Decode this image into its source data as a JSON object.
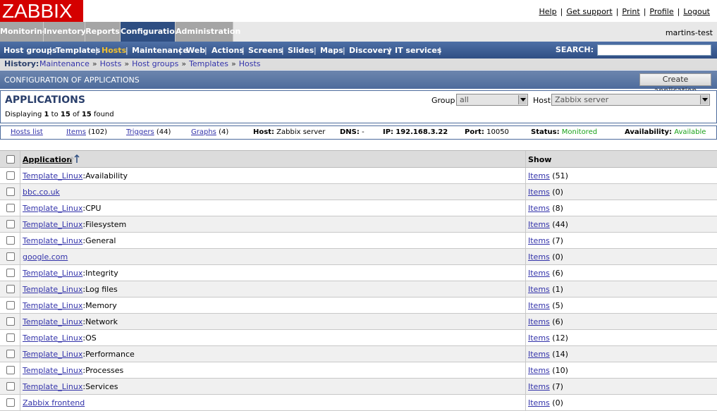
{
  "logo": "ZABBIX",
  "top_links": [
    "Help",
    "Get support",
    "Print",
    "Profile",
    "Logout"
  ],
  "main_menu": [
    {
      "label": "Monitoring",
      "active": false
    },
    {
      "label": "Inventory",
      "active": false
    },
    {
      "label": "Reports",
      "active": false
    },
    {
      "label": "Configuration",
      "active": true
    },
    {
      "label": "Administration",
      "active": false
    }
  ],
  "user": "martins-test",
  "sub_menu": [
    {
      "label": "Host groups",
      "active": false
    },
    {
      "label": "Templates",
      "active": false
    },
    {
      "label": "Hosts",
      "active": true
    },
    {
      "label": "Maintenance",
      "active": false
    },
    {
      "label": "Web",
      "active": false
    },
    {
      "label": "Actions",
      "active": false
    },
    {
      "label": "Screens",
      "active": false
    },
    {
      "label": "Slides",
      "active": false
    },
    {
      "label": "Maps",
      "active": false
    },
    {
      "label": "Discovery",
      "active": false
    },
    {
      "label": "IT services",
      "active": false
    }
  ],
  "search_label": "SEARCH:",
  "history": {
    "label": "History:",
    "crumbs": [
      "Maintenance",
      "Hosts",
      "Host groups",
      "Templates",
      "Hosts"
    ]
  },
  "config_bar": {
    "title": "CONFIGURATION OF APPLICATIONS",
    "create_button": "Create application"
  },
  "apps_panel": {
    "heading": "APPLICATIONS",
    "displaying": {
      "prefix": "Displaying",
      "from": "1",
      "to_word": "to",
      "to": "15",
      "of_word": "of",
      "total": "15",
      "suffix": "found"
    },
    "group_label": "Group",
    "group_value": "all",
    "host_label": "Host",
    "host_value": "Zabbix server"
  },
  "host_bar": {
    "hosts_list": "Hosts list",
    "items_label": "Items",
    "items_count": "(102)",
    "triggers_label": "Triggers",
    "triggers_count": "(44)",
    "graphs_label": "Graphs",
    "graphs_count": "(4)",
    "host_label": "Host:",
    "host_value": "Zabbix server",
    "dns_label": "DNS:",
    "dns_value": "-",
    "ip_label": "IP:",
    "ip_value": "192.168.3.22",
    "port_label": "Port:",
    "port_value": "10050",
    "status_label": "Status:",
    "status_value": "Monitored",
    "availability_label": "Availability:",
    "availability_value": "Available"
  },
  "table": {
    "col_application": "Application",
    "col_show": "Show",
    "rows": [
      {
        "prefix": "Template_Linux",
        "name": "Availability",
        "items": "Items",
        "count": "(51)"
      },
      {
        "prefix": "",
        "name": "bbc.co.uk",
        "items": "Items",
        "count": "(0)"
      },
      {
        "prefix": "Template_Linux",
        "name": "CPU",
        "items": "Items",
        "count": "(8)"
      },
      {
        "prefix": "Template_Linux",
        "name": "Filesystem",
        "items": "Items",
        "count": "(44)"
      },
      {
        "prefix": "Template_Linux",
        "name": "General",
        "items": "Items",
        "count": "(7)"
      },
      {
        "prefix": "",
        "name": "google.com",
        "items": "Items",
        "count": "(0)"
      },
      {
        "prefix": "Template_Linux",
        "name": "Integrity",
        "items": "Items",
        "count": "(6)"
      },
      {
        "prefix": "Template_Linux",
        "name": "Log files",
        "items": "Items",
        "count": "(1)"
      },
      {
        "prefix": "Template_Linux",
        "name": "Memory",
        "items": "Items",
        "count": "(5)"
      },
      {
        "prefix": "Template_Linux",
        "name": "Network",
        "items": "Items",
        "count": "(6)"
      },
      {
        "prefix": "Template_Linux",
        "name": "OS",
        "items": "Items",
        "count": "(12)"
      },
      {
        "prefix": "Template_Linux",
        "name": "Performance",
        "items": "Items",
        "count": "(14)"
      },
      {
        "prefix": "Template_Linux",
        "name": "Processes",
        "items": "Items",
        "count": "(10)"
      },
      {
        "prefix": "Template_Linux",
        "name": "Services",
        "items": "Items",
        "count": "(7)"
      },
      {
        "prefix": "",
        "name": "Zabbix frontend",
        "items": "Items",
        "count": "(0)"
      }
    ]
  },
  "colors": {
    "logo_red": "#d40000",
    "nav_blue": "#2e4e82",
    "active_yellow": "#f0c030",
    "link_blue": "#3333aa",
    "status_green": "#1aa21a"
  }
}
